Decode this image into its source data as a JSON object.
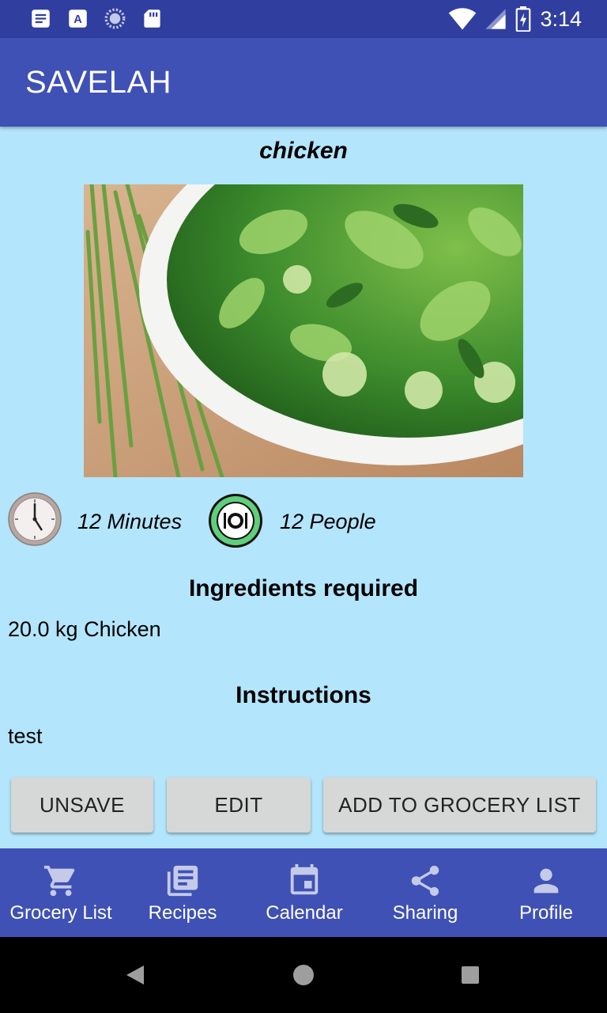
{
  "status_bar": {
    "time": "3:14",
    "left_icons": [
      "notes-icon",
      "font-download-icon",
      "sync-spinner-icon",
      "sd-card-icon"
    ],
    "right_icons": [
      "wifi-icon",
      "cell-signal-icon",
      "battery-charging-icon"
    ]
  },
  "app_bar": {
    "title": "SAVELAH"
  },
  "recipe": {
    "title": "chicken",
    "time": "12 Minutes",
    "servings": "12 People"
  },
  "ingredients": {
    "heading": "Ingredients required",
    "items": [
      "20.0 kg Chicken"
    ]
  },
  "instructions": {
    "heading": "Instructions",
    "text": "test"
  },
  "actions": {
    "unsave_label": "UNSAVE",
    "edit_label": "EDIT",
    "add_label": "ADD TO GROCERY LIST"
  },
  "bottom_nav": {
    "items": [
      {
        "label": "Grocery List",
        "icon": "cart-icon"
      },
      {
        "label": "Recipes",
        "icon": "recipes-icon"
      },
      {
        "label": "Calendar",
        "icon": "calendar-icon"
      },
      {
        "label": "Sharing",
        "icon": "share-icon"
      },
      {
        "label": "Profile",
        "icon": "person-icon"
      }
    ]
  },
  "colors": {
    "status_bar": "#303f9f",
    "app_bar": "#3f51b5",
    "background": "#b3e5fc",
    "button": "#d6d7d7"
  }
}
